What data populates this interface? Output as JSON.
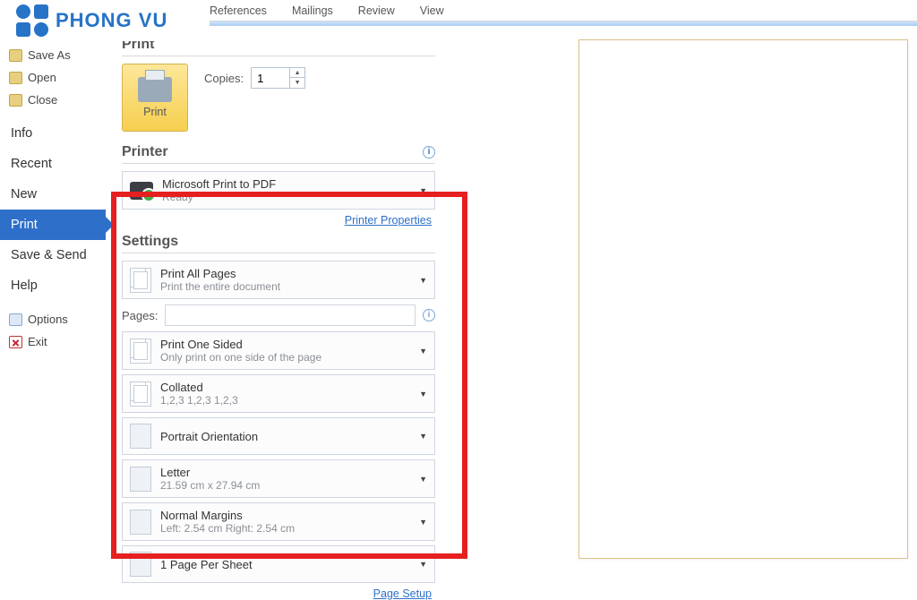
{
  "logo": {
    "text": "PHONG VU"
  },
  "ribbon": {
    "references": "References",
    "mailings": "Mailings",
    "review": "Review",
    "view": "View"
  },
  "nav": {
    "save_as": "Save As",
    "open": "Open",
    "close": "Close",
    "info": "Info",
    "recent": "Recent",
    "new": "New",
    "print": "Print",
    "save_send": "Save & Send",
    "help": "Help",
    "options": "Options",
    "exit": "Exit"
  },
  "print": {
    "header": "Print",
    "btn": "Print",
    "copies_label": "Copies:",
    "copies_value": "1"
  },
  "printer": {
    "header": "Printer",
    "name": "Microsoft Print to PDF",
    "status": "Ready",
    "properties": "Printer Properties"
  },
  "settings": {
    "header": "Settings",
    "scope": {
      "title": "Print All Pages",
      "sub": "Print the entire document"
    },
    "pages_label": "Pages:",
    "pages_value": "",
    "sided": {
      "title": "Print One Sided",
      "sub": "Only print on one side of the page"
    },
    "collate": {
      "title": "Collated",
      "sub": "1,2,3    1,2,3    1,2,3"
    },
    "orient": {
      "title": "Portrait Orientation"
    },
    "paper": {
      "title": "Letter",
      "sub": "21.59 cm x 27.94 cm"
    },
    "margins": {
      "title": "Normal Margins",
      "sub": "Left:  2.54 cm    Right:  2.54 cm"
    },
    "sheet": {
      "title": "1 Page Per Sheet"
    },
    "page_setup": "Page Setup"
  }
}
